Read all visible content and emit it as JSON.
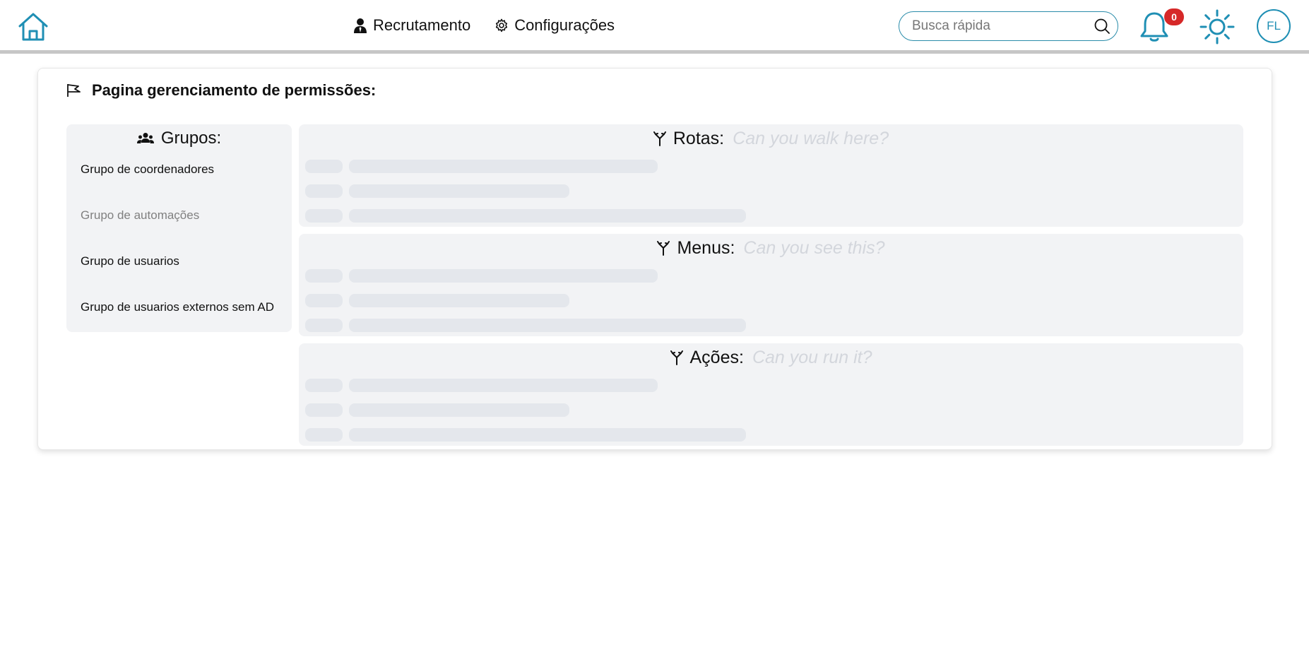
{
  "topbar": {
    "nav": [
      {
        "label": "Recrutamento",
        "icon": "user-tie-icon"
      },
      {
        "label": "Configurações",
        "icon": "gear-icon"
      }
    ],
    "search": {
      "placeholder": "Busca rápida"
    },
    "notifications": {
      "count": "0"
    },
    "avatar": {
      "initials": "FL"
    }
  },
  "page": {
    "title": "Pagina gerenciamento de permissões:"
  },
  "groups": {
    "header": "Grupos:",
    "items": [
      {
        "label": "Grupo de coordenadores",
        "disabled": false
      },
      {
        "label": "Grupo de automações",
        "disabled": true
      },
      {
        "label": "Grupo de usuarios",
        "disabled": false
      },
      {
        "label": "Grupo de usuarios externos sem AD",
        "disabled": false
      }
    ]
  },
  "panels": [
    {
      "title": "Rotas:",
      "hint": "Can you walk here?"
    },
    {
      "title": "Menus:",
      "hint": "Can you see this?"
    },
    {
      "title": "Ações:",
      "hint": "Can you run it?"
    }
  ],
  "colors": {
    "accent": "#1f8fb4",
    "badge": "#d62828",
    "panel_bg": "#f2f3f5",
    "skeleton": "#e4e7ec"
  }
}
